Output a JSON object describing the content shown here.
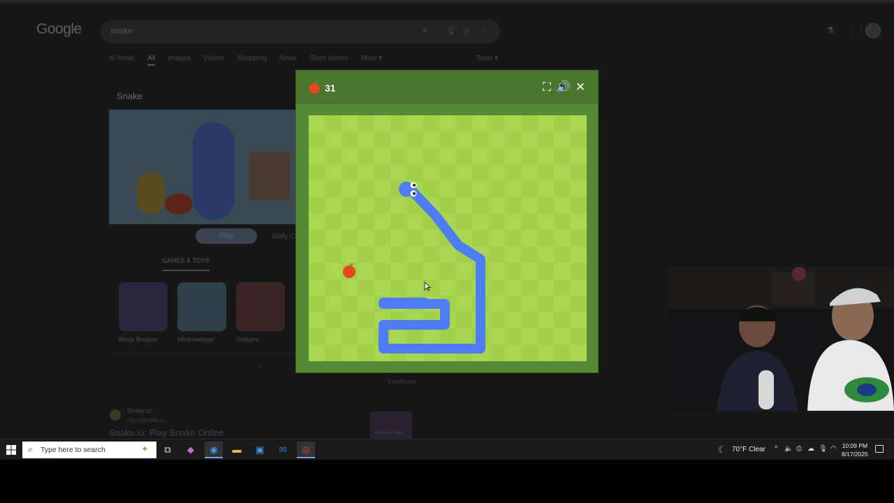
{
  "google": {
    "logo": "Google",
    "search_query": "snake",
    "tabs": [
      "AI Mode",
      "All",
      "Images",
      "Videos",
      "Shopping",
      "News",
      "Short videos",
      "More ▾"
    ],
    "tools": "Tools ▾",
    "card_title": "Snake",
    "play_label": "Play",
    "daily_label": "Daily Ch",
    "games_heading": "GAMES & TOYS",
    "games": [
      "Block Breaker",
      "Minesweeper",
      "Solitaire"
    ],
    "feedback": "Feedback",
    "result_site_name": "Snake.io",
    "result_site_url": "https://snake.io",
    "result_title": "Snake.io: Play Snake Online",
    "thumb_text": "Snake.io Trailer"
  },
  "game": {
    "score": "31",
    "board_columns": 17,
    "board_rows": 15,
    "colors": {
      "light": "#aad751",
      "dark": "#a2d149",
      "snake": "#4e7cf6",
      "apple": "#e7471d",
      "frame": "#578a34",
      "header": "#4a752c"
    }
  },
  "taskbar": {
    "search_placeholder": "Type here to search",
    "weather": "70°F  Clear",
    "time": "10:09 PM",
    "date": "8/17/2025",
    "apps": [
      "task-view-icon",
      "copilot-icon",
      "edge-icon",
      "file-explorer-icon",
      "store-icon",
      "outlook-icon",
      "chrome-icon"
    ]
  }
}
